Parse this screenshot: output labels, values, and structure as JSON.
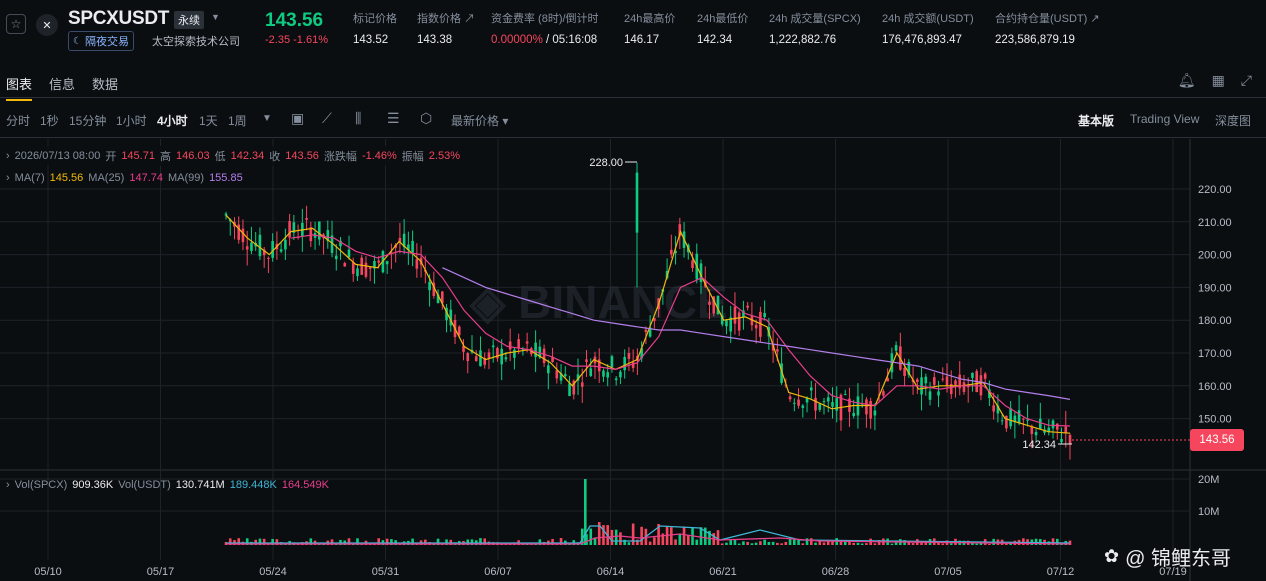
{
  "header": {
    "symbol": "SPCXUSDT",
    "perp_tag": "永续",
    "night_tag": "隔夜交易",
    "company": "太空探索技术公司",
    "last_price": "143.56",
    "change": "-2.35 -1.61%",
    "stats": [
      {
        "label": "标记价格",
        "value": "143.52"
      },
      {
        "label": "指数价格 ↗",
        "value": "143.38"
      },
      {
        "label": "资金费率 (8时)/倒计时",
        "value_red": "0.00000%",
        "value": " / 05:16:08"
      },
      {
        "label": "24h最高价",
        "value": "146.17"
      },
      {
        "label": "24h最低价",
        "value": "142.34"
      },
      {
        "label": "24h 成交量(SPCX)",
        "value": "1,222,882.76"
      },
      {
        "label": "24h 成交额(USDT)",
        "value": "176,476,893.47"
      },
      {
        "label": "合约持仓量(USDT) ↗",
        "value": "223,586,879.19"
      }
    ]
  },
  "tabs": [
    "图表",
    "信息",
    "数据"
  ],
  "toolbar": {
    "timeframes": [
      "分时",
      "1秒",
      "15分钟",
      "1小时",
      "4小时",
      "1天",
      "1周"
    ],
    "active_timeframe": "4小时",
    "price_type": "最新价格 ▾",
    "modes": [
      "基本版",
      "Trading View",
      "深度图"
    ]
  },
  "info": {
    "datetime": "2026/07/13 08:00",
    "open_label": "开",
    "open": "145.71",
    "high_label": "高",
    "high": "146.03",
    "low_label": "低",
    "low": "142.34",
    "close_label": "收",
    "close": "143.56",
    "chg_label": "涨跌幅",
    "chg": "-1.46%",
    "amp_label": "振幅",
    "amp": "2.53%"
  },
  "ma": {
    "ma7_label": "MA(7)",
    "ma7": "145.56",
    "ma25_label": "MA(25)",
    "ma25": "147.74",
    "ma99_label": "MA(99)",
    "ma99": "155.85"
  },
  "vol": {
    "vol_spcx_label": "Vol(SPCX)",
    "vol_spcx": "909.36K",
    "vol_usdt_label": "Vol(USDT)",
    "vol_usdt": "130.741M",
    "v1": "189.448K",
    "v2": "164.549K"
  },
  "price_tag": "143.56",
  "colors": {
    "up": "#0ecb81",
    "down": "#f6465d",
    "ma7": "#f0b90b",
    "ma25": "#e83e8c",
    "ma99": "#b37feb",
    "accent": "#f0b90b"
  },
  "chart_data": {
    "type": "line",
    "title": "",
    "y_ticks": [
      "220.00",
      "210.00",
      "200.00",
      "190.00",
      "180.00",
      "170.00",
      "160.00",
      "150.00"
    ],
    "x_ticks": [
      "05/10",
      "05/17",
      "05/24",
      "05/31",
      "06/07",
      "06/14",
      "06/21",
      "06/28",
      "07/05",
      "07/12",
      "07/19"
    ],
    "vol_ticks": [
      "20M",
      "10M"
    ],
    "ylim": [
      140,
      230
    ],
    "max_label": "228.00",
    "min_label": "142.34",
    "series": [
      {
        "name": "MA(7)",
        "values": [
          212,
          205,
          200,
          207,
          208,
          203,
          197,
          196,
          204,
          198,
          185,
          172,
          168,
          170,
          171,
          167,
          160,
          168,
          165,
          168,
          185,
          207,
          193,
          180,
          181,
          178,
          158,
          156,
          153,
          154,
          154,
          170,
          159,
          160,
          160,
          161,
          150,
          148,
          146,
          145.56
        ]
      },
      {
        "name": "MA(25)",
        "values": [
          null,
          null,
          null,
          205,
          206,
          205,
          201,
          199,
          201,
          200,
          193,
          183,
          176,
          172,
          171,
          169,
          166,
          166,
          165,
          167,
          175,
          190,
          193,
          187,
          182,
          180,
          171,
          163,
          157,
          155,
          154,
          160,
          160,
          159,
          160,
          160,
          154,
          150,
          148,
          147.74
        ]
      },
      {
        "name": "MA(99)",
        "values": [
          null,
          null,
          null,
          null,
          null,
          null,
          null,
          null,
          null,
          null,
          196,
          193,
          190,
          188,
          186,
          184,
          182,
          180,
          179,
          178,
          177,
          177,
          176,
          175,
          174,
          173,
          172,
          171,
          170,
          169,
          168,
          167,
          166,
          164,
          162,
          161,
          159,
          158,
          157,
          155.85
        ]
      }
    ]
  }
}
